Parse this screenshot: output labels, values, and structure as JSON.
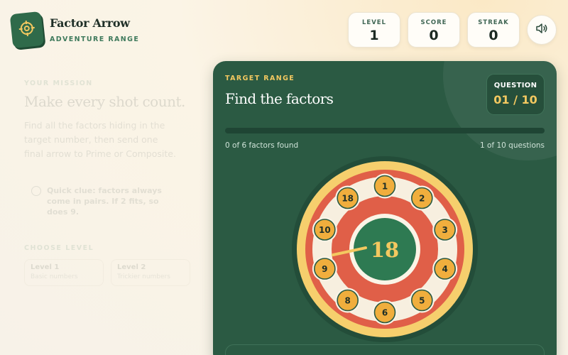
{
  "brand": {
    "title": "Factor Arrow",
    "subtitle": "ADVENTURE RANGE",
    "logo_icon": "target-icon"
  },
  "stats": [
    {
      "label": "LEVEL",
      "value": "1"
    },
    {
      "label": "SCORE",
      "value": "0"
    },
    {
      "label": "STREAK",
      "value": "0"
    }
  ],
  "sound_icon": "speaker-icon",
  "mission": {
    "kicker": "YOUR MISSION",
    "title": "Make every shot count.",
    "description": "Find all the factors hiding in the target number, then send one final arrow to Prime or Composite.",
    "clue": "Quick clue: factors always come in pairs. If 2 fits, so does 9.",
    "level_kicker": "CHOOSE LEVEL",
    "levels": [
      {
        "title": "Level 1",
        "subtitle": "Basic numbers"
      },
      {
        "title": "Level 2",
        "subtitle": "Trickier numbers"
      }
    ]
  },
  "game": {
    "kicker": "TARGET RANGE",
    "title": "Find the factors",
    "question_label": "QUESTION",
    "question_value": "01 / 10",
    "progress": 0,
    "found_text": "0 of 6 factors found",
    "questions_text": "1 of 10 questions",
    "target_number": "18",
    "ring_numbers": [
      "1",
      "2",
      "3",
      "4",
      "5",
      "6",
      "8",
      "9",
      "10",
      "18"
    ],
    "colors": {
      "panel": "#2b5a43",
      "outer_ring": "#f6cf6d",
      "red_ring": "#e05f48",
      "bead": "#f0ae3d",
      "center": "#2e7a52"
    }
  }
}
